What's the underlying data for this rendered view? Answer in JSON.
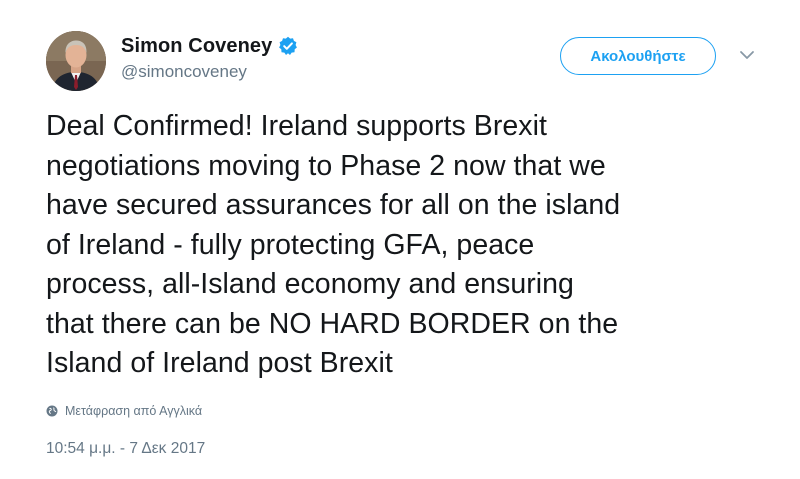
{
  "author": {
    "display_name": "Simon Coveney",
    "handle": "@simoncoveney",
    "verified": true,
    "avatar_icon": "profile-photo"
  },
  "actions": {
    "follow_label": "Ακολουθήστε",
    "more_icon": "chevron-down-icon"
  },
  "tweet": {
    "text": "Deal Confirmed! Ireland supports Brexit\nnegotiations moving to Phase 2 now that we\nhave secured assurances for all on the island\nof Ireland - fully protecting GFA, peace\nprocess, all-Island economy and ensuring\nthat there can be NO HARD BORDER on the\nIsland of Ireland post Brexit",
    "translate_label": "Μετάφραση από Αγγλικά",
    "timestamp": "10:54 μ.μ. - 7 Δεκ 2017"
  },
  "colors": {
    "accent": "#1da1f2",
    "text_primary": "#14171a",
    "text_secondary": "#657786"
  }
}
